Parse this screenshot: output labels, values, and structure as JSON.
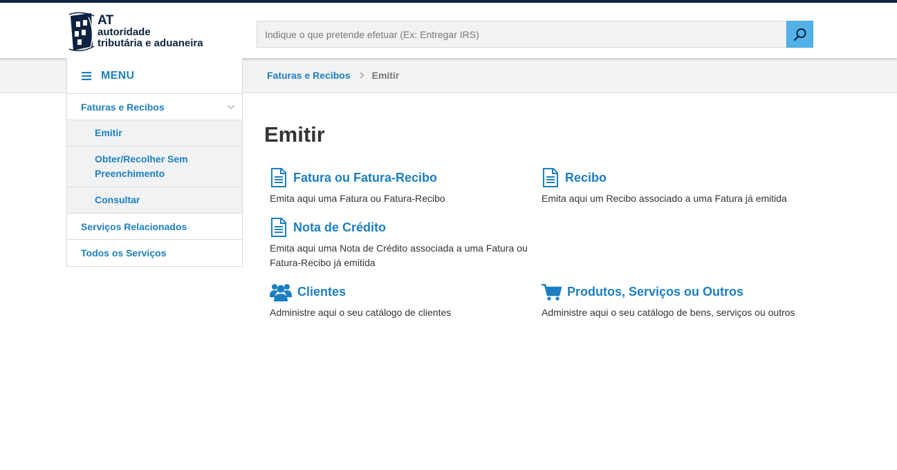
{
  "brand": {
    "line1": "AT",
    "line2": "autoridade",
    "line3": "tributária e aduaneira",
    "color": "#0d2240"
  },
  "search": {
    "placeholder": "Indique o que pretende efetuar (Ex: Entregar IRS)",
    "value": "",
    "icon": "search-icon",
    "button_color": "#53b1e8"
  },
  "menu": {
    "label": "MENU",
    "icon": "hamburger-icon"
  },
  "sidebar": {
    "items": [
      {
        "label": "Faturas e Recibos",
        "level": "top",
        "expanded": true
      },
      {
        "label": "Emitir",
        "level": "sub"
      },
      {
        "label": "Obter/Recolher Sem Preenchimento",
        "level": "sub"
      },
      {
        "label": "Consultar",
        "level": "sub"
      },
      {
        "label": "Serviços Relacionados",
        "level": "top"
      },
      {
        "label": "Todos os Serviços",
        "level": "top"
      }
    ]
  },
  "breadcrumb": {
    "parent": "Faturas e Recibos",
    "current": "Emitir"
  },
  "page": {
    "title": "Emitir"
  },
  "services": [
    {
      "title": "Fatura ou Fatura-Recibo",
      "description": "Emita aqui uma Fatura ou Fatura-Recibo",
      "icon": "document-icon"
    },
    {
      "title": "Recibo",
      "description": "Emita aqui um Recibo associado a uma Fatura já emitida",
      "icon": "document-icon"
    },
    {
      "title": "Nota de Crédito",
      "description": "Emita aqui uma Nota de Crédito associada a uma Fatura ou Fatura-Recibo já emitida",
      "icon": "document-icon"
    },
    {
      "title": "Clientes",
      "description": "Administre aqui o seu catálogo de clientes",
      "icon": "users-icon"
    },
    {
      "title": "Produtos, Serviços ou Outros",
      "description": "Administre aqui o seu catálogo de bens, serviços ou outros",
      "icon": "shopping-cart-icon"
    }
  ],
  "colors": {
    "accent": "#1b7ec2",
    "text": "#333333",
    "muted": "#777777",
    "panel": "#f1f2f3"
  }
}
